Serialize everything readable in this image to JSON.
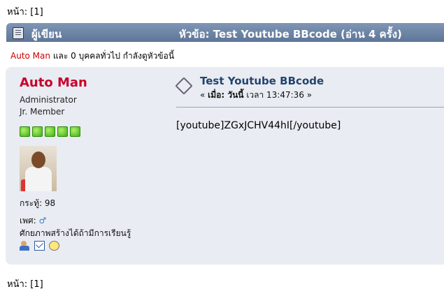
{
  "pagination": {
    "label": "หน้า:",
    "current": "[1]"
  },
  "header": {
    "author": "ผู้เขียน",
    "topic": "หัวข้อ: Test Youtube BBcode  (อ่าน 4 ครั้ง)"
  },
  "viewers": {
    "user": "Auto Man",
    "rest": " และ 0 บุคคลทั่วไป กำลังดูหัวข้อนี้"
  },
  "poster": {
    "name": "Auto Man",
    "group": "Administrator",
    "rank": "Jr. Member",
    "stars": 5,
    "posts": "กระทู้: 98",
    "gender_label": "เพศ:",
    "gender_icon": "male-icon",
    "signature": "ศักยภาพสร้างได้ถ้ามีการเรียนรู้",
    "icons": [
      "profile-icon",
      "email-icon",
      "pm-icon"
    ]
  },
  "post": {
    "subject": "Test Youtube BBcode",
    "meta_prefix": "« ",
    "meta_when": "เมื่อ: วันนี้",
    "meta_time": " เวลา 13:47:36 »",
    "body": "[youtube]ZGxJCHV44hI[/youtube]"
  }
}
